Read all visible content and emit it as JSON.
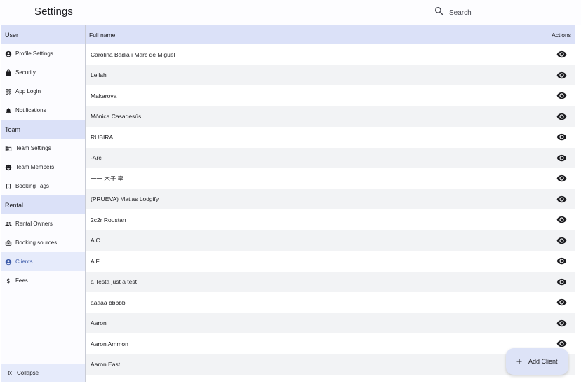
{
  "header": {
    "title": "Settings",
    "search_placeholder": "Search"
  },
  "sidebar": {
    "sections": [
      {
        "title": "User",
        "items": [
          {
            "label": "Profile Settings",
            "icon": "account-circle-icon"
          },
          {
            "label": "Security",
            "icon": "lock-icon"
          },
          {
            "label": "App Login",
            "icon": "qr-code-icon"
          },
          {
            "label": "Notifications",
            "icon": "bell-icon"
          }
        ]
      },
      {
        "title": "Team",
        "items": [
          {
            "label": "Team Settings",
            "icon": "corporate-icon"
          },
          {
            "label": "Team Members",
            "icon": "group-face-icon"
          },
          {
            "label": "Booking Tags",
            "icon": "bookmark-icon"
          }
        ]
      },
      {
        "title": "Rental",
        "items": [
          {
            "label": "Rental Owners",
            "icon": "people-icon"
          },
          {
            "label": "Booking sources",
            "icon": "briefcase-icon"
          },
          {
            "label": "Clients",
            "icon": "account-circle-icon",
            "active": true
          },
          {
            "label": "Fees",
            "icon": "dollar-icon"
          }
        ]
      }
    ],
    "collapse_label": "Collapse"
  },
  "table": {
    "columns": {
      "name": "Full name",
      "actions": "Actions"
    },
    "rows": [
      "Carolina Badia i Marc de Miguel",
      "Leilah",
      "Makarova",
      "Mònica Casadesús",
      "RUBIRA",
      "-Arc",
      "一一 木子 李",
      "(PRUEVA) Matias Lodgify",
      "2c2r Roustan",
      "A C",
      "A F",
      "a Testa just a test",
      "aaaaa bbbbb",
      "Aaron",
      "Aaron Ammon",
      "Aaron East"
    ]
  },
  "fab": {
    "label": "Add Client",
    "icon": "plus-icon"
  },
  "colors": {
    "accent": "#3c5aa8",
    "header_bg": "#dbe1f8",
    "row_alt": "#f2f3f5",
    "fab_bg": "#dde3f7"
  }
}
